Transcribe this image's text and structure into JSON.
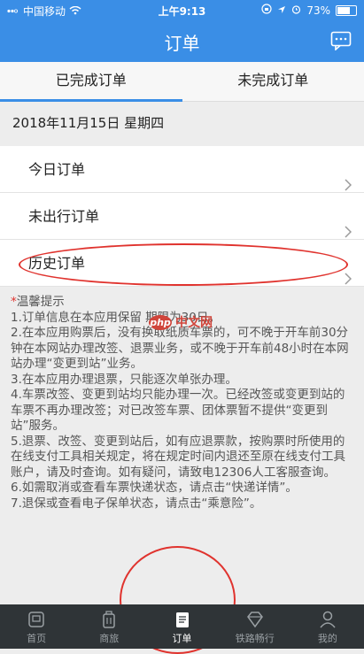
{
  "status_bar": {
    "carrier": "中国移动",
    "time": "上午9:13",
    "battery": "73%",
    "battery_level": 0.73
  },
  "header": {
    "title": "订单",
    "message_icon": "chat-icon"
  },
  "tabs": [
    {
      "label": "已完成订单",
      "active": true
    },
    {
      "label": "未完成订单",
      "active": false
    }
  ],
  "date_label": "2018年11月15日 星期四",
  "order_list": [
    {
      "label": "今日订单"
    },
    {
      "label": "未出行订单"
    },
    {
      "label": "历史订单"
    }
  ],
  "tips": {
    "title": "温馨提示",
    "items": [
      "1.订单信息在本应用保留 期限为30日。",
      "2.在本应用购票后，没有换取纸质车票的，可不晚于开车前30分钟在本网站办理改签、退票业务，或不晚于开车前48小时在本网站办理“变更到站”业务。",
      "3.在本应用办理退票，只能逐次单张办理。",
      "4.车票改签、变更到站均只能办理一次。已经改签或变更到站的车票不再办理改签；对已改签车票、团体票暂不提供“变更到站”服务。",
      "5.退票、改签、变更到站后，如有应退票款，按购票时所使用的在线支付工具相关规定，将在规定时间内退还至原在线支付工具账户，请及时查询。如有疑问，请致电12306人工客服查询。",
      "6.如需取消或查看车票快递状态，请点击“快递详情”。",
      "7.退保或查看电子保单状态，请点击“乘意险”。"
    ]
  },
  "watermark": {
    "badge": "php",
    "text": "中文网"
  },
  "bottom_nav": [
    {
      "label": "首页",
      "icon": "home-icon",
      "active": false
    },
    {
      "label": "商旅",
      "icon": "luggage-icon",
      "active": false
    },
    {
      "label": "订单",
      "icon": "order-icon",
      "active": true
    },
    {
      "label": "铁路畅行",
      "icon": "diamond-icon",
      "active": false
    },
    {
      "label": "我的",
      "icon": "user-icon",
      "active": false
    }
  ],
  "colors": {
    "primary": "#3a8ee6",
    "annotation": "#e0332e",
    "bottom_bar": "#2f3437"
  }
}
